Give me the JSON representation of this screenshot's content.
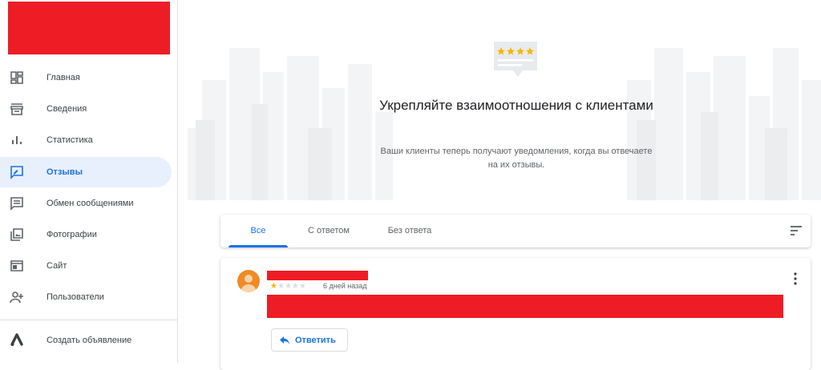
{
  "sidebar": {
    "items": [
      {
        "label": "Главная",
        "icon": "dashboard-icon"
      },
      {
        "label": "Сведения",
        "icon": "storefront-icon"
      },
      {
        "label": "Статистика",
        "icon": "bar-chart-icon"
      },
      {
        "label": "Отзывы",
        "icon": "reviews-icon",
        "active": true
      },
      {
        "label": "Обмен сообщениями",
        "icon": "message-icon"
      },
      {
        "label": "Фотографии",
        "icon": "photo-library-icon"
      },
      {
        "label": "Сайт",
        "icon": "website-icon"
      },
      {
        "label": "Пользователи",
        "icon": "add-user-icon"
      }
    ],
    "ads": {
      "label": "Создать объявление",
      "icon": "google-ads-icon"
    }
  },
  "hero": {
    "title": "Укрепляйте взаимоотношения с клиентами",
    "subtitle": "Ваши клиенты теперь получают уведомления, когда вы отвечаете на их отзывы."
  },
  "tabs": [
    {
      "label": "Все",
      "active": true
    },
    {
      "label": "С ответом"
    },
    {
      "label": "Без ответа"
    }
  ],
  "review": {
    "rating": 1,
    "max_rating": 5,
    "age": "6 дней назад",
    "reply_label": "Ответить"
  },
  "colors": {
    "accent": "#1a73e8",
    "active_bg": "#e8f0fe",
    "star": "#f6b700",
    "redaction": "#ee1c25",
    "avatar": "#f08a24"
  }
}
